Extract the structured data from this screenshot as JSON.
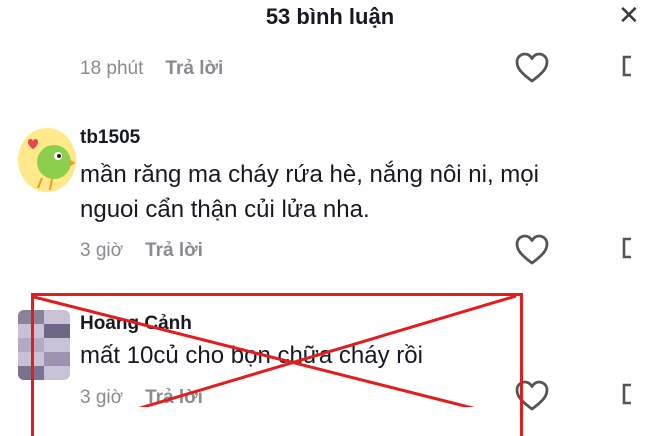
{
  "header": {
    "title": "53 bình luận",
    "close_icon": "close-icon"
  },
  "comments": [
    {
      "time": "18 phút",
      "reply_label": "Trả lời"
    },
    {
      "username": "tb1505",
      "text_line1": "mần răng ma cháy rứa hè, nắng nôi ni, mọi",
      "text_line2": "nguoi cẩn thận củi lửa nha.",
      "time": "3 giờ",
      "reply_label": "Trả lời"
    },
    {
      "username": "Hoàng Cảnh",
      "text_line1": "mất 10củ cho bọn chữa cháy rồi",
      "time": "3 giờ",
      "reply_label": "Trả lời",
      "marked_with_red_x": true
    }
  ],
  "colors": {
    "accent_red": "#e11d1d",
    "meta_gray": "#8a8b91",
    "text": "#161823"
  }
}
